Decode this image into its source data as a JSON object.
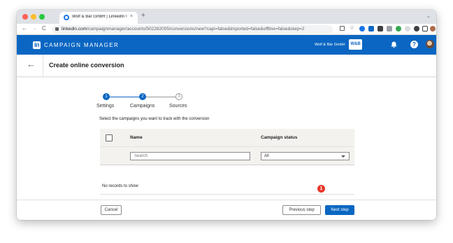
{
  "browser": {
    "tab_title": "Wolf & Bär GmbH | LinkedIn C",
    "tab_close": "×",
    "new_tab": "+",
    "url_domain": "linkedin.com",
    "url_path": "/campaignmanager/accounts/502282005/conversions/new?capi=false&imported=false&offline=false&step=2",
    "nav_back": "←",
    "nav_forward": "→",
    "nav_reload": "C",
    "tabstrip_menu": "⌄"
  },
  "header": {
    "logo": "in",
    "app_name": "CAMPAIGN MANAGER",
    "account_name": "Wolf & Bär GmbH",
    "account_logo": "W&B",
    "help": "?"
  },
  "page": {
    "back_arrow": "←",
    "title": "Create online conversion"
  },
  "steps": [
    {
      "number": "1",
      "label": "Settings",
      "state": "done"
    },
    {
      "number": "2",
      "label": "Campaigns",
      "state": "current"
    },
    {
      "number": "3",
      "label": "Sources",
      "state": "todo"
    }
  ],
  "main": {
    "instruction": "Select the campaigns you want to track with the conversion",
    "table": {
      "columns": [
        "Name",
        "Campaign status"
      ],
      "search_placeholder": "Search",
      "status_filter": "All",
      "empty_text": "No records to show"
    }
  },
  "footer": {
    "cancel": "Cancel",
    "previous": "Previous step",
    "next": "Next step",
    "marker": "1"
  },
  "colors": {
    "linkedin_blue": "#0a66c2",
    "marker_red": "#e8352a"
  }
}
